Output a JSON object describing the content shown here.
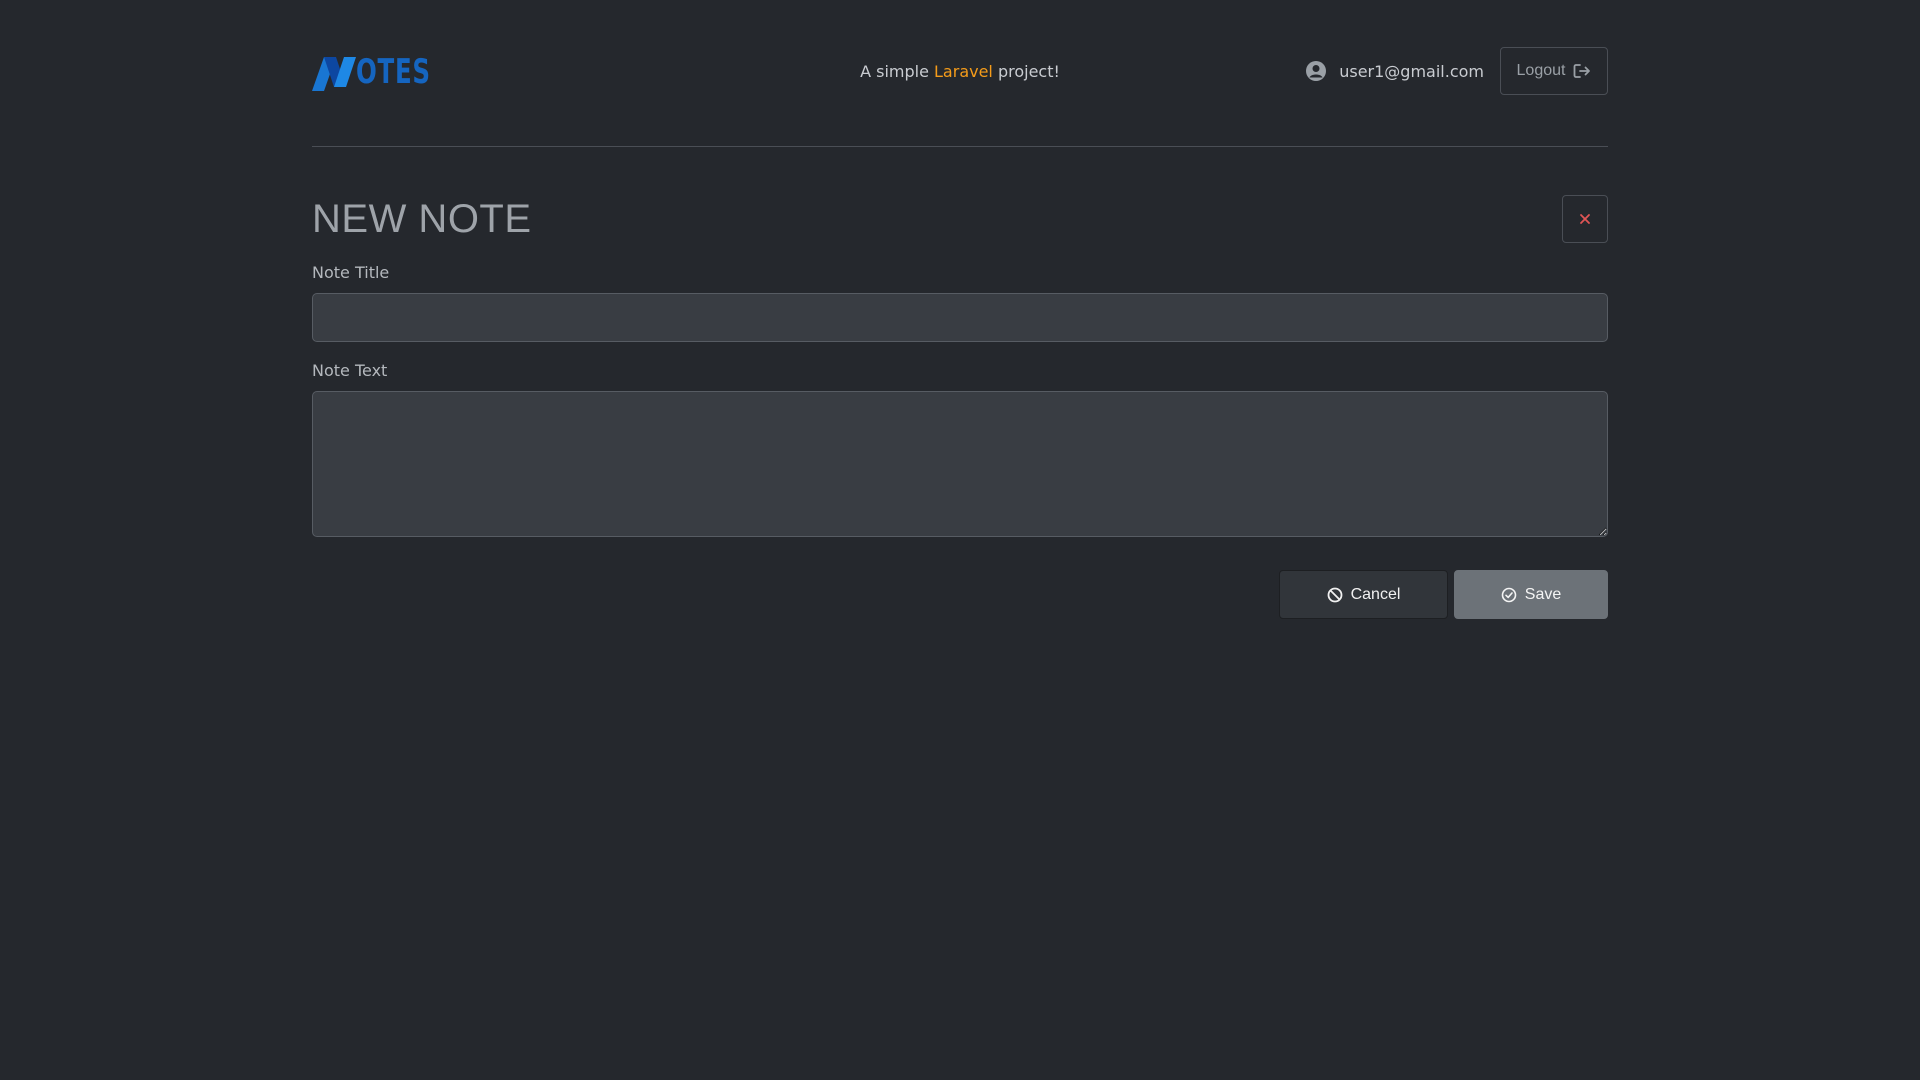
{
  "header": {
    "logo_text": "OTES",
    "tagline_prefix": "A simple ",
    "tagline_accent": "Laravel",
    "tagline_suffix": " project!",
    "user_email": "user1@gmail.com",
    "logout_label": "Logout"
  },
  "main": {
    "title": "NEW NOTE",
    "note_title_label": "Note Title",
    "note_title_value": "",
    "note_text_label": "Note Text",
    "note_text_value": "",
    "cancel_label": "Cancel",
    "save_label": "Save"
  },
  "icons": {
    "logo": "notes-logo-icon",
    "user": "user-circle-icon",
    "logout": "logout-icon",
    "close": "close-icon",
    "cancel": "ban-icon",
    "save": "check-circle-icon"
  },
  "colors": {
    "background": "#25282d",
    "accent": "#f59c1a",
    "brand": "#1565c0",
    "close_x": "#e05555",
    "save_button": "#6c7278",
    "input_background": "#393d43"
  }
}
